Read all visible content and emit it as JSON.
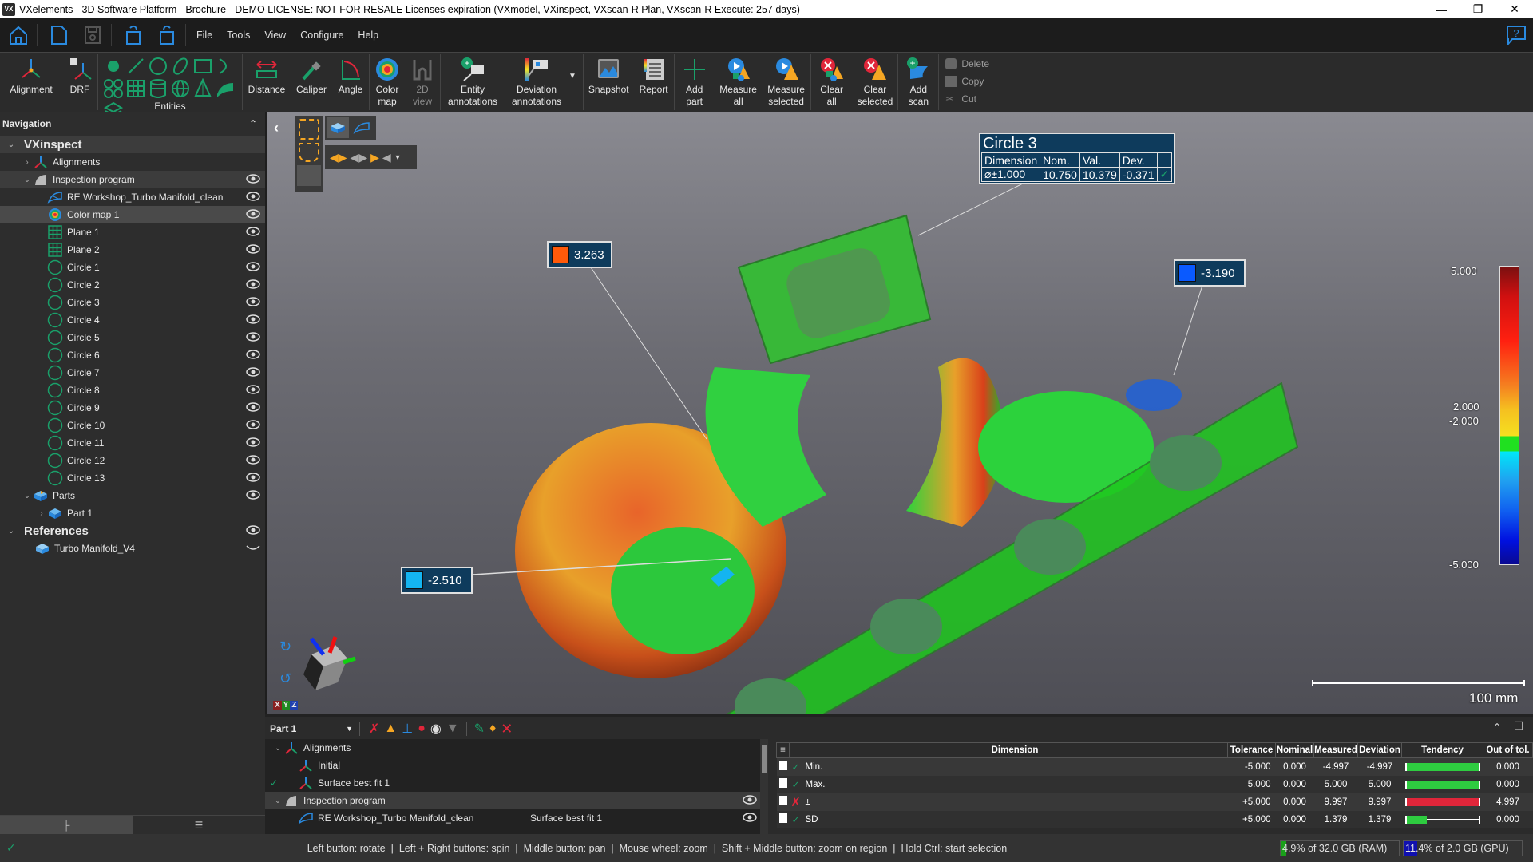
{
  "window": {
    "title": "VXelements - 3D Software Platform - Brochure - DEMO LICENSE: NOT FOR RESALE Licenses expiration (VXmodel, VXinspect, VXscan-R Plan, VXscan-R Execute: 257 days)",
    "app_icon": "VX"
  },
  "menu": {
    "items": [
      "File",
      "Tools",
      "View",
      "Configure",
      "Help"
    ]
  },
  "ribbon": {
    "alignment": "Alignment",
    "drf": "DRF",
    "entities": "Entities",
    "distance": "Distance",
    "caliper": "Caliper",
    "angle": "Angle",
    "color_map": [
      "Color",
      "map"
    ],
    "view_2d": [
      "2D",
      "view"
    ],
    "entity_annotations": [
      "Entity",
      "annotations"
    ],
    "deviation_annotations": [
      "Deviation",
      "annotations"
    ],
    "snapshot": "Snapshot",
    "report": "Report",
    "add_part": [
      "Add",
      "part"
    ],
    "measure_all": [
      "Measure",
      "all"
    ],
    "measure_selected": [
      "Measure",
      "selected"
    ],
    "clear_all": [
      "Clear",
      "all"
    ],
    "clear_selected": [
      "Clear",
      "selected"
    ],
    "add_scan": [
      "Add",
      "scan"
    ],
    "delete": "Delete",
    "copy": "Copy",
    "cut": "Cut"
  },
  "navigation": {
    "title": "Navigation",
    "root": "VXinspect",
    "alignments": "Alignments",
    "inspection_program": "Inspection program",
    "items": [
      {
        "label": "RE Workshop_Turbo Manifold_clean",
        "icon": "mesh-icon"
      },
      {
        "label": "Color map 1",
        "icon": "color-map-icon",
        "selected": true
      },
      {
        "label": "Plane 1",
        "icon": "plane-icon"
      },
      {
        "label": "Plane 2",
        "icon": "plane-icon"
      },
      {
        "label": "Circle 1",
        "icon": "circle-icon"
      },
      {
        "label": "Circle 2",
        "icon": "circle-icon"
      },
      {
        "label": "Circle 3",
        "icon": "circle-icon"
      },
      {
        "label": "Circle 4",
        "icon": "circle-icon"
      },
      {
        "label": "Circle 5",
        "icon": "circle-icon"
      },
      {
        "label": "Circle 6",
        "icon": "circle-icon"
      },
      {
        "label": "Circle 7",
        "icon": "circle-icon"
      },
      {
        "label": "Circle 8",
        "icon": "circle-icon"
      },
      {
        "label": "Circle 9",
        "icon": "circle-icon"
      },
      {
        "label": "Circle 10",
        "icon": "circle-icon"
      },
      {
        "label": "Circle 11",
        "icon": "circle-icon"
      },
      {
        "label": "Circle 12",
        "icon": "circle-icon"
      },
      {
        "label": "Circle 13",
        "icon": "circle-icon"
      }
    ],
    "parts": "Parts",
    "part1": "Part 1",
    "references": "References",
    "reference_item": "Turbo Manifold_V4"
  },
  "viewport": {
    "circle_callout": {
      "title": "Circle 3",
      "headers": [
        "Dimension",
        "Nom.",
        "Val.",
        "Dev."
      ],
      "row": [
        "⌀±1.000",
        "10.750",
        "10.379",
        "-0.371"
      ],
      "status": "pass"
    },
    "deviation_callouts": [
      {
        "value": "3.263",
        "color": "#ff5a0a"
      },
      {
        "value": "-3.190",
        "color": "#0a5aff"
      },
      {
        "value": "-2.510",
        "color": "#14b4f0"
      }
    ],
    "color_scale": {
      "labels": [
        "5.000",
        "2.000",
        "-2.000",
        "-5.000"
      ],
      "max": 5.0,
      "upper_tol": 2.0,
      "lower_tol": -2.0,
      "min": -5.0
    },
    "scale_bar": "100 mm",
    "axis_labels": [
      "X",
      "Y",
      "Z"
    ]
  },
  "bottom_panel": {
    "part_selector": "Part 1",
    "tree": [
      {
        "label": "Alignments",
        "level": 0
      },
      {
        "label": "Initial",
        "level": 1
      },
      {
        "label": "Surface best fit 1",
        "level": 1,
        "checked": true
      },
      {
        "label": "Inspection program",
        "level": 0
      },
      {
        "label": "RE Workshop_Turbo Manifold_clean",
        "level": 1,
        "ref": "Surface best fit 1"
      }
    ],
    "table": {
      "headers": [
        "Dimension",
        "Tolerance",
        "Nominal",
        "Measured",
        "Deviation",
        "Tendency",
        "Out of tol."
      ],
      "rows": [
        {
          "name": "Min.",
          "status": "pass",
          "tolerance": "-5.000",
          "nominal": "0.000",
          "measured": "-4.997",
          "deviation": "-4.997",
          "tendency": 1.0,
          "tendency_color": "#2ecc40",
          "out": "0.000"
        },
        {
          "name": "Max.",
          "status": "pass",
          "tolerance": "5.000",
          "nominal": "0.000",
          "measured": "5.000",
          "deviation": "5.000",
          "tendency": 1.0,
          "tendency_color": "#2ecc40",
          "out": "0.000"
        },
        {
          "name": "±",
          "status": "fail",
          "tolerance": "+5.000",
          "nominal": "0.000",
          "measured": "9.997",
          "deviation": "9.997",
          "tendency": 1.0,
          "tendency_color": "#e0263a",
          "out": "4.997"
        },
        {
          "name": "SD",
          "status": "pass",
          "tolerance": "+5.000",
          "nominal": "0.000",
          "measured": "1.379",
          "deviation": "1.379",
          "tendency": 0.28,
          "tendency_color": "#2ecc40",
          "out": "0.000"
        }
      ]
    }
  },
  "status": {
    "hint": "Left button: rotate  |  Left + Right buttons: spin  |  Middle button: pan  |  Mouse wheel: zoom  |  Shift + Middle button: zoom on region  |  Hold Ctrl: start selection",
    "ram": "4.9% of 32.0 GB (RAM)",
    "ram_pct": 4.9,
    "gpu": "11.4% of 2.0 GB (GPU)",
    "gpu_pct": 11.4
  }
}
